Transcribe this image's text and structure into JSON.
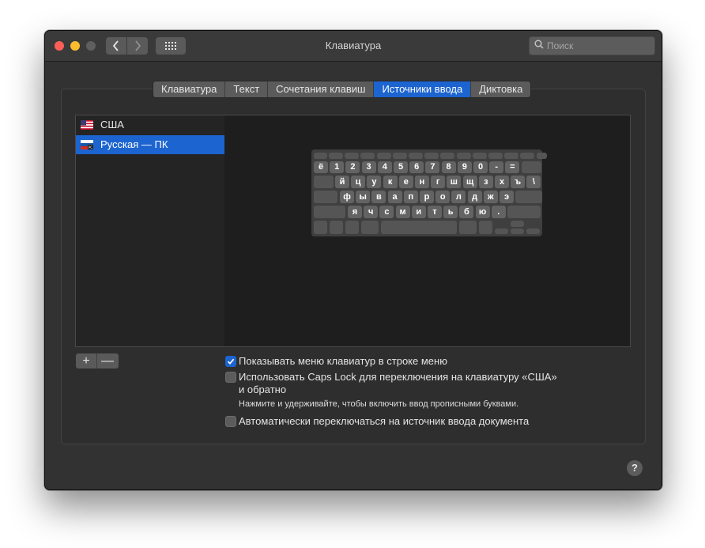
{
  "window": {
    "title": "Клавиатура"
  },
  "toolbar": {
    "search_placeholder": "Поиск"
  },
  "tabs": [
    {
      "label": "Клавиатура"
    },
    {
      "label": "Текст"
    },
    {
      "label": "Сочетания клавиш"
    },
    {
      "label": "Источники ввода",
      "active": true
    },
    {
      "label": "Диктовка"
    }
  ],
  "input_sources": [
    {
      "label": "США",
      "flag": "us-flag-icon",
      "selected": false
    },
    {
      "label": "Русская — ПК",
      "flag": "ru-flag-icon",
      "flag_badge": "PC",
      "selected": true
    }
  ],
  "keyboard": {
    "row1": [
      "ё",
      "1",
      "2",
      "3",
      "4",
      "5",
      "6",
      "7",
      "8",
      "9",
      "0",
      "-",
      "="
    ],
    "row2": [
      "й",
      "ц",
      "у",
      "к",
      "е",
      "н",
      "г",
      "ш",
      "щ",
      "з",
      "х",
      "ъ",
      "\\"
    ],
    "row3": [
      "ф",
      "ы",
      "в",
      "а",
      "п",
      "р",
      "о",
      "л",
      "д",
      "ж",
      "э"
    ],
    "row4": [
      "я",
      "ч",
      "с",
      "м",
      "и",
      "т",
      "ь",
      "б",
      "ю",
      "."
    ]
  },
  "list_controls": {
    "add": "+",
    "remove": "—"
  },
  "options": {
    "show_menu": {
      "label": "Показывать меню клавиатур в строке меню",
      "checked": true
    },
    "caps_lock": {
      "label_line1": "Использовать Caps Lock для переключения на клавиатуру «США»",
      "label_line2": "и обратно",
      "hint": "Нажмите и удерживайте, чтобы включить ввод прописными буквами.",
      "checked": false
    },
    "auto_switch": {
      "label": "Автоматически переключаться на источник ввода документа",
      "checked": false
    }
  },
  "help": {
    "label": "?"
  },
  "colors": {
    "accent": "#1c64d0",
    "window_bg": "#323232",
    "list_bg": "#242424"
  }
}
